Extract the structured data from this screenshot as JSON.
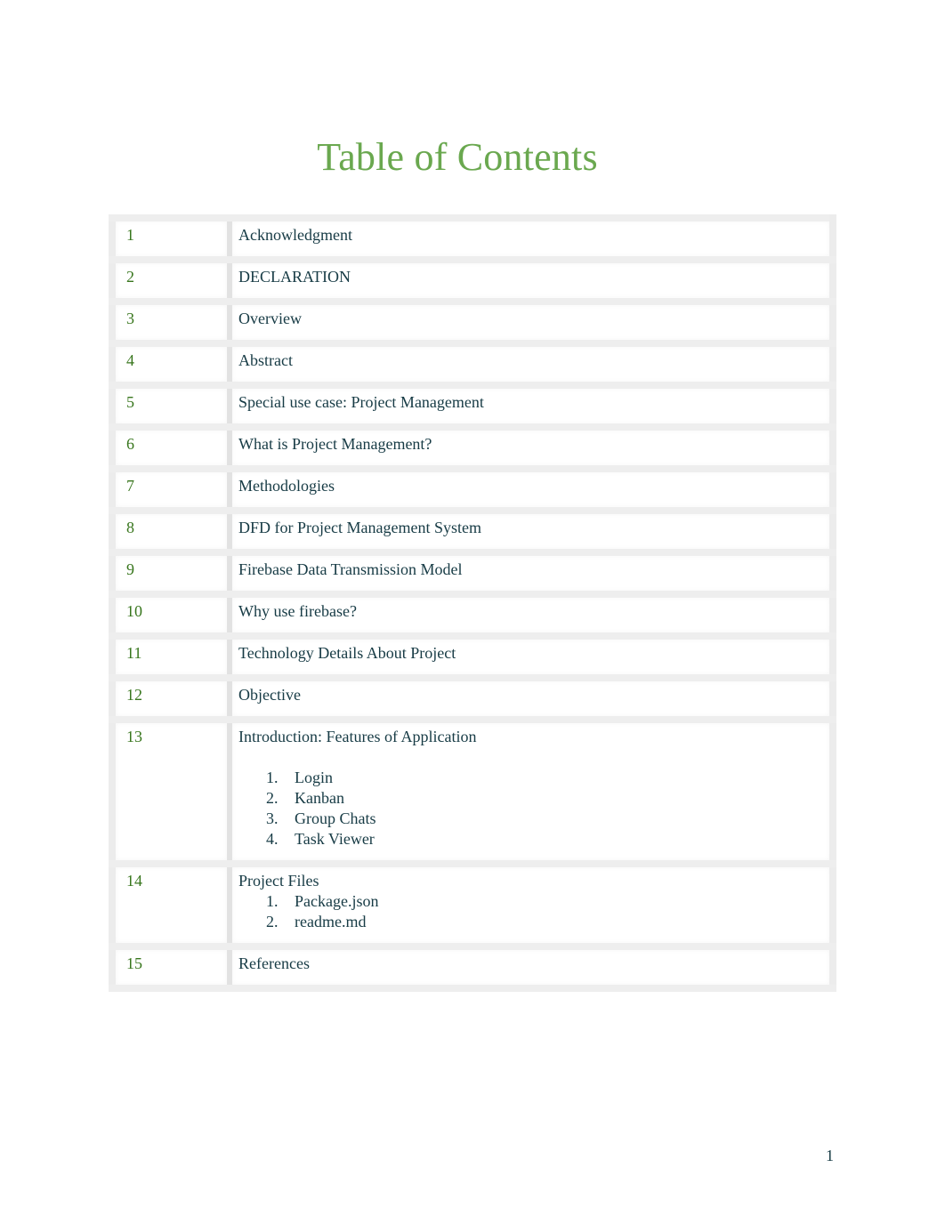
{
  "document": {
    "title": "Table of Contents",
    "page_number": "1",
    "colors": {
      "title": "#6aa84f",
      "numbers": "#38761d",
      "text": "#173b45",
      "grid": "#e6e6e6"
    }
  },
  "toc": {
    "entries": [
      {
        "num": "1",
        "label": "Acknowledgment"
      },
      {
        "num": "2",
        "label": "DECLARATION"
      },
      {
        "num": "3",
        "label": "Overview"
      },
      {
        "num": "4",
        "label": "Abstract"
      },
      {
        "num": "5",
        "label": "Special use case: Project Management"
      },
      {
        "num": "6",
        "label": "What is Project Management?"
      },
      {
        "num": "7",
        "label": "Methodologies"
      },
      {
        "num": "8",
        "label": "DFD for Project Management System"
      },
      {
        "num": "9",
        "label": "Firebase Data Transmission Model"
      },
      {
        "num": "10",
        "label": "Why use firebase?"
      },
      {
        "num": "11",
        "label": "Technology Details About Project"
      },
      {
        "num": "12",
        "label": "Objective"
      },
      {
        "num": "13",
        "label": "Introduction: Features of Application",
        "subitems": [
          {
            "idx": "1.",
            "label": "Login"
          },
          {
            "idx": "2.",
            "label": "Kanban"
          },
          {
            "idx": "3.",
            "label": "Group Chats"
          },
          {
            "idx": "4.",
            "label": "Task Viewer"
          }
        ]
      },
      {
        "num": "14",
        "label": "Project Files",
        "subitems": [
          {
            "idx": "1.",
            "label": "Package.json"
          },
          {
            "idx": "2.",
            "label": "readme.md"
          }
        ]
      },
      {
        "num": "15",
        "label": "References"
      }
    ]
  }
}
